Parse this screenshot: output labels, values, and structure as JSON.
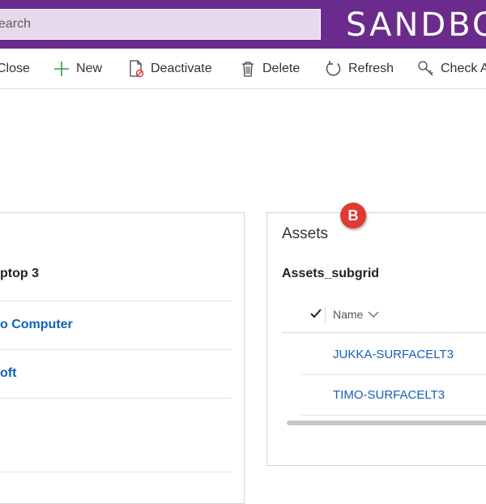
{
  "header": {
    "search_text": "earch",
    "environment_label": "SANDBOX"
  },
  "commands": [
    {
      "label": "Close",
      "icon": "close-icon"
    },
    {
      "label": "New",
      "icon": "plus-icon"
    },
    {
      "label": "Deactivate",
      "icon": "deactivate-icon"
    },
    {
      "label": "Delete",
      "icon": "trash-icon"
    },
    {
      "label": "Refresh",
      "icon": "refresh-icon"
    },
    {
      "label": "Check A",
      "icon": "check-access-icon"
    }
  ],
  "left_panel": {
    "fields": [
      "ptop 3",
      "o Computer",
      "oft"
    ]
  },
  "assets_panel": {
    "title": "Assets",
    "subgrid_name": "Assets_subgrid",
    "column_name": "Name",
    "rows": [
      "JUKKA-SURFACELT3",
      "TIMO-SURFACELT3"
    ]
  },
  "badge": "B",
  "colors": {
    "header_bg": "#6a2b8c",
    "search_bg": "#e6d9ec",
    "link": "#1260b8",
    "badge": "#e13a32",
    "new_icon": "#2e9b47"
  }
}
